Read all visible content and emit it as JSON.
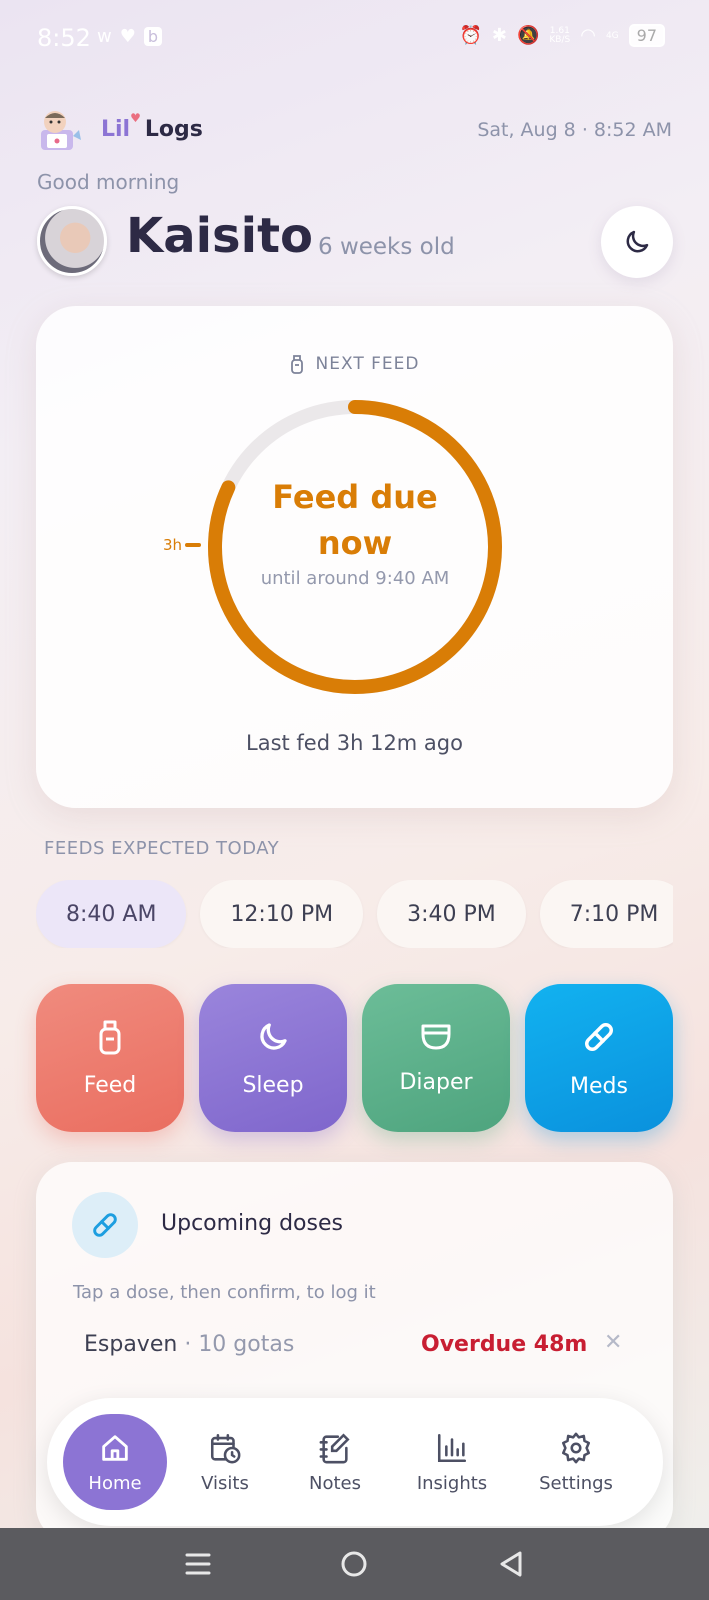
{
  "status_bar": {
    "time": "8:52",
    "left_icons": [
      "w-icon",
      "heart-icon",
      "b-icon"
    ],
    "net_speed_top": "1.61",
    "net_speed_bottom": "KB/S",
    "signal_label": "4G",
    "battery": "97"
  },
  "header": {
    "logo_lil": "Lil",
    "logo_logs": "Logs",
    "datetime": "Sat, Aug 8 · 8:52 AM",
    "greeting": "Good morning",
    "baby_name": "Kaisito",
    "baby_age": "6 weeks old"
  },
  "feed_card": {
    "label": "NEXT FEED",
    "status": "Feed due now",
    "until": "until around 9:40 AM",
    "tick_label": "3h",
    "last_fed": "Last fed 3h 12m ago",
    "progress_fraction": 0.82,
    "accent_color": "#d97d06"
  },
  "feeds_expected": {
    "label": "FEEDS EXPECTED TODAY",
    "times": [
      "8:40 AM",
      "12:10 PM",
      "3:40 PM",
      "7:10 PM"
    ]
  },
  "actions": {
    "feed": "Feed",
    "sleep": "Sleep",
    "diaper": "Diaper",
    "meds": "Meds"
  },
  "doses": {
    "title": "Upcoming doses",
    "hint": "Tap a dose, then confirm, to log it",
    "items": [
      {
        "name": "Espaven",
        "amount": "10 gotas",
        "status": "Overdue 48m"
      }
    ]
  },
  "nav": {
    "home": "Home",
    "visits": "Visits",
    "notes": "Notes",
    "insights": "Insights",
    "settings": "Settings"
  }
}
